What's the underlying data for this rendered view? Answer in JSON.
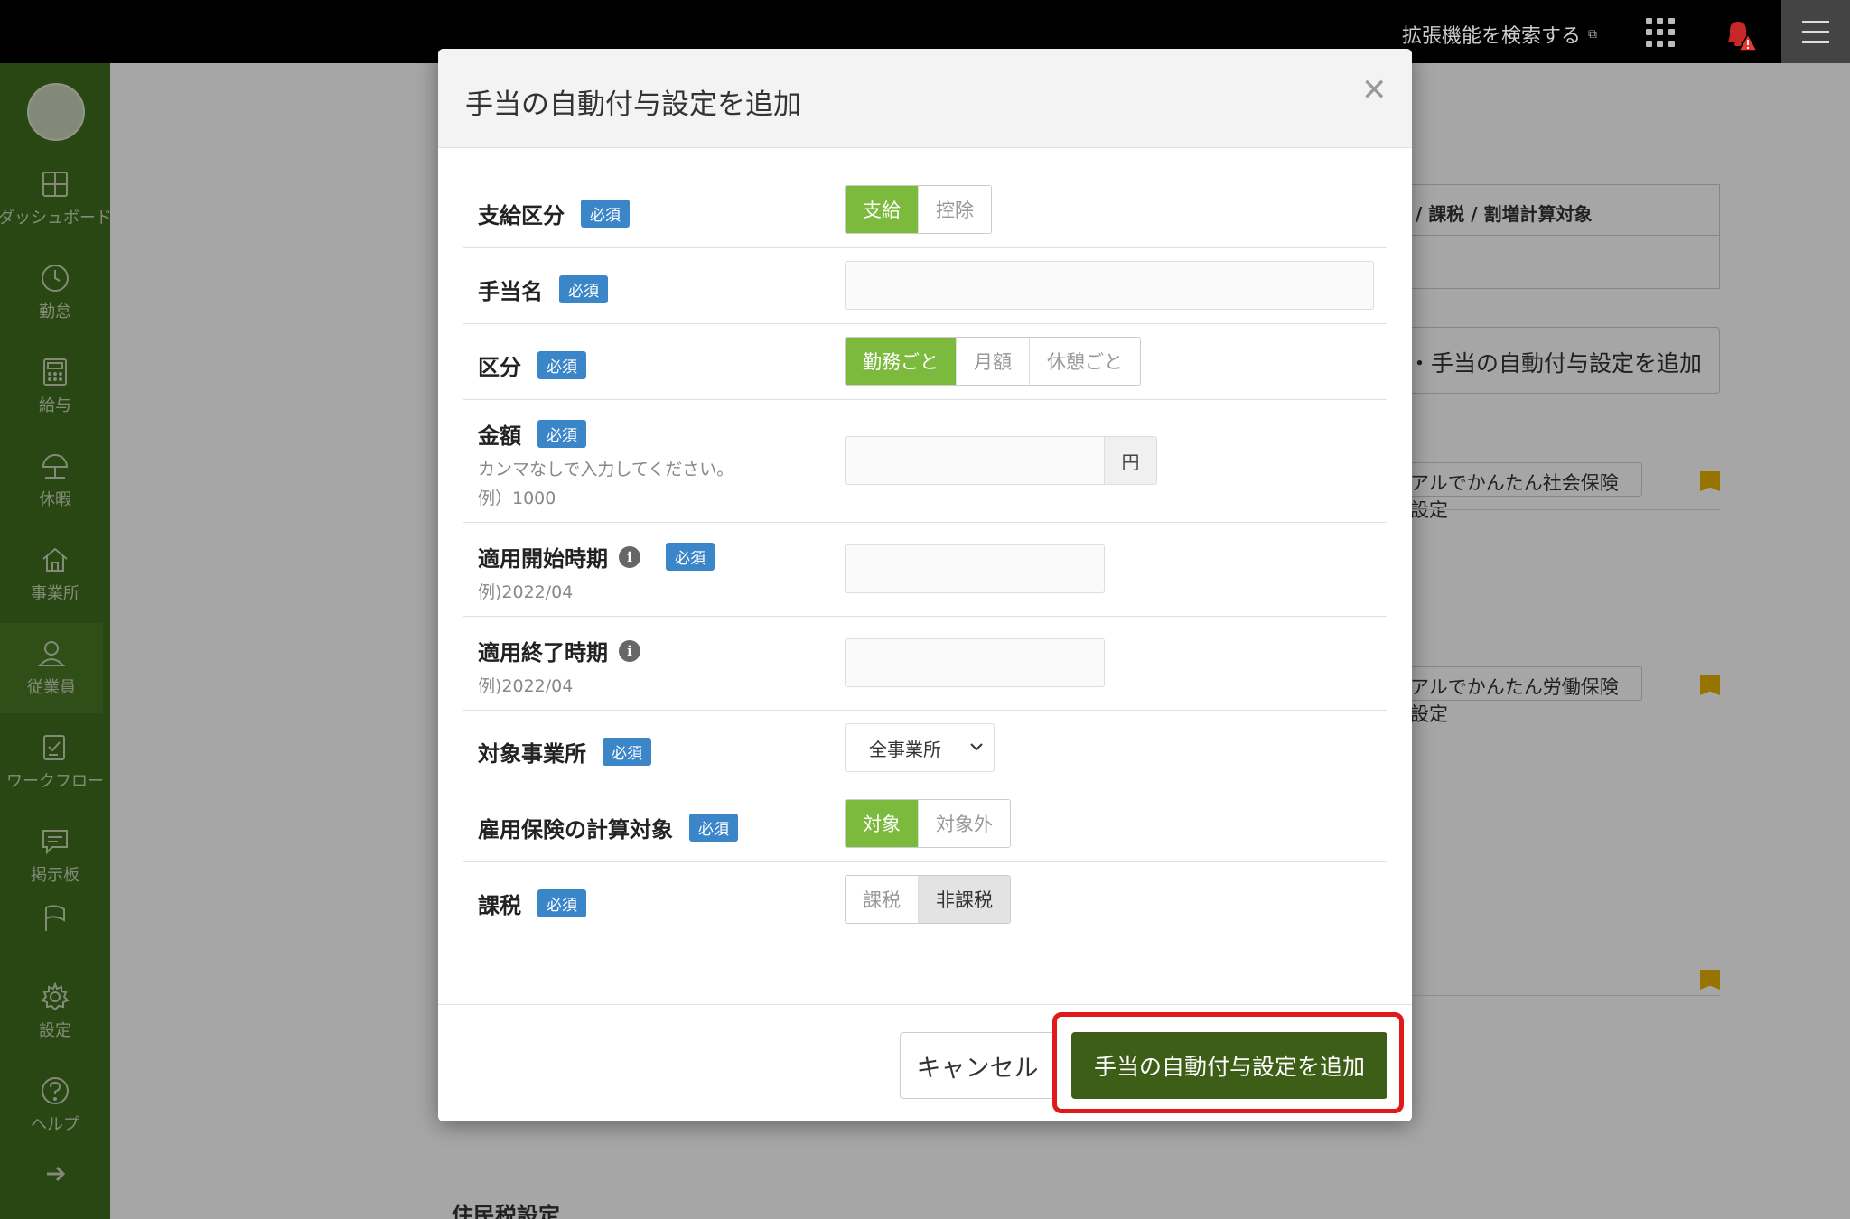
{
  "topbar": {
    "extension_search": "拡張機能を検索する",
    "notification_alert_color": "#e53935"
  },
  "sidebar": {
    "items": [
      {
        "label": "ダッシュボード",
        "icon": "dashboard-icon"
      },
      {
        "label": "勤怠",
        "icon": "clock-icon"
      },
      {
        "label": "給与",
        "icon": "calculator-icon"
      },
      {
        "label": "休暇",
        "icon": "umbrella-icon"
      },
      {
        "label": "事業所",
        "icon": "home-icon"
      },
      {
        "label": "従業員",
        "icon": "person-icon",
        "active": true
      },
      {
        "label": "ワークフロー",
        "icon": "checklist-icon"
      },
      {
        "label": "掲示板",
        "icon": "chat-icon"
      },
      {
        "label": "",
        "icon": "flag-icon"
      },
      {
        "label": "設定",
        "icon": "gear-icon"
      },
      {
        "label": "ヘルプ",
        "icon": "help-icon"
      },
      {
        "label": "",
        "icon": "arrow-right-icon"
      }
    ]
  },
  "background": {
    "table_header": "/ 課税 / 割増計算対象",
    "add_button": "・手当の自動付与設定を追加",
    "social_insurance_link": "アルでかんたん社会保険設定",
    "labor_insurance_link": "アルでかんたん労働保険設定",
    "resident_tax_heading": "住民税設定"
  },
  "modal": {
    "title": "手当の自動付与設定を追加",
    "required_badge": "必須",
    "fields": {
      "payment_type": {
        "label": "支給区分",
        "options": [
          "支給",
          "控除"
        ],
        "selected": "支給"
      },
      "allowance_name": {
        "label": "手当名",
        "value": ""
      },
      "category": {
        "label": "区分",
        "options": [
          "勤務ごと",
          "月額",
          "休憩ごと"
        ],
        "selected": "勤務ごと"
      },
      "amount": {
        "label": "金額",
        "hint1": "カンマなしで入力してください。",
        "hint2": "例）1000",
        "unit": "円",
        "value": ""
      },
      "start_period": {
        "label": "適用開始時期",
        "hint": "例)2022/04",
        "value": ""
      },
      "end_period": {
        "label": "適用終了時期",
        "hint": "例)2022/04",
        "value": ""
      },
      "target_office": {
        "label": "対象事業所",
        "selected": "全事業所"
      },
      "employment_insurance": {
        "label": "雇用保険の計算対象",
        "options": [
          "対象",
          "対象外"
        ],
        "selected": "対象"
      },
      "taxation": {
        "label": "課税",
        "options": [
          "課税",
          "非課税"
        ],
        "selected": "非課税"
      }
    },
    "cancel_label": "キャンセル",
    "submit_label": "手当の自動付与設定を追加"
  },
  "colors": {
    "accent_green": "#7cba3e",
    "submit_green": "#3d5e17",
    "badge_blue": "#3b86c9",
    "highlight_red": "#e01919",
    "sidebar_green": "#3f6e1e"
  }
}
